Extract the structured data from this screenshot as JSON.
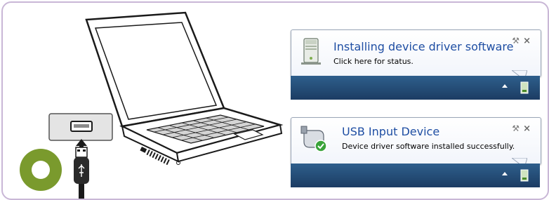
{
  "toast1": {
    "title": "Installing device driver software",
    "message": "Click here for status.",
    "icon": "computer-icon"
  },
  "toast2": {
    "title": "USB Input Device",
    "message": "Device driver software installed successfully.",
    "icon": "usb-device-check-icon"
  },
  "colors": {
    "frame_border": "#c9b7d6",
    "title_blue": "#1f4ea3",
    "taskbar": "#24507a",
    "step_circle": "#7a9a2d"
  }
}
